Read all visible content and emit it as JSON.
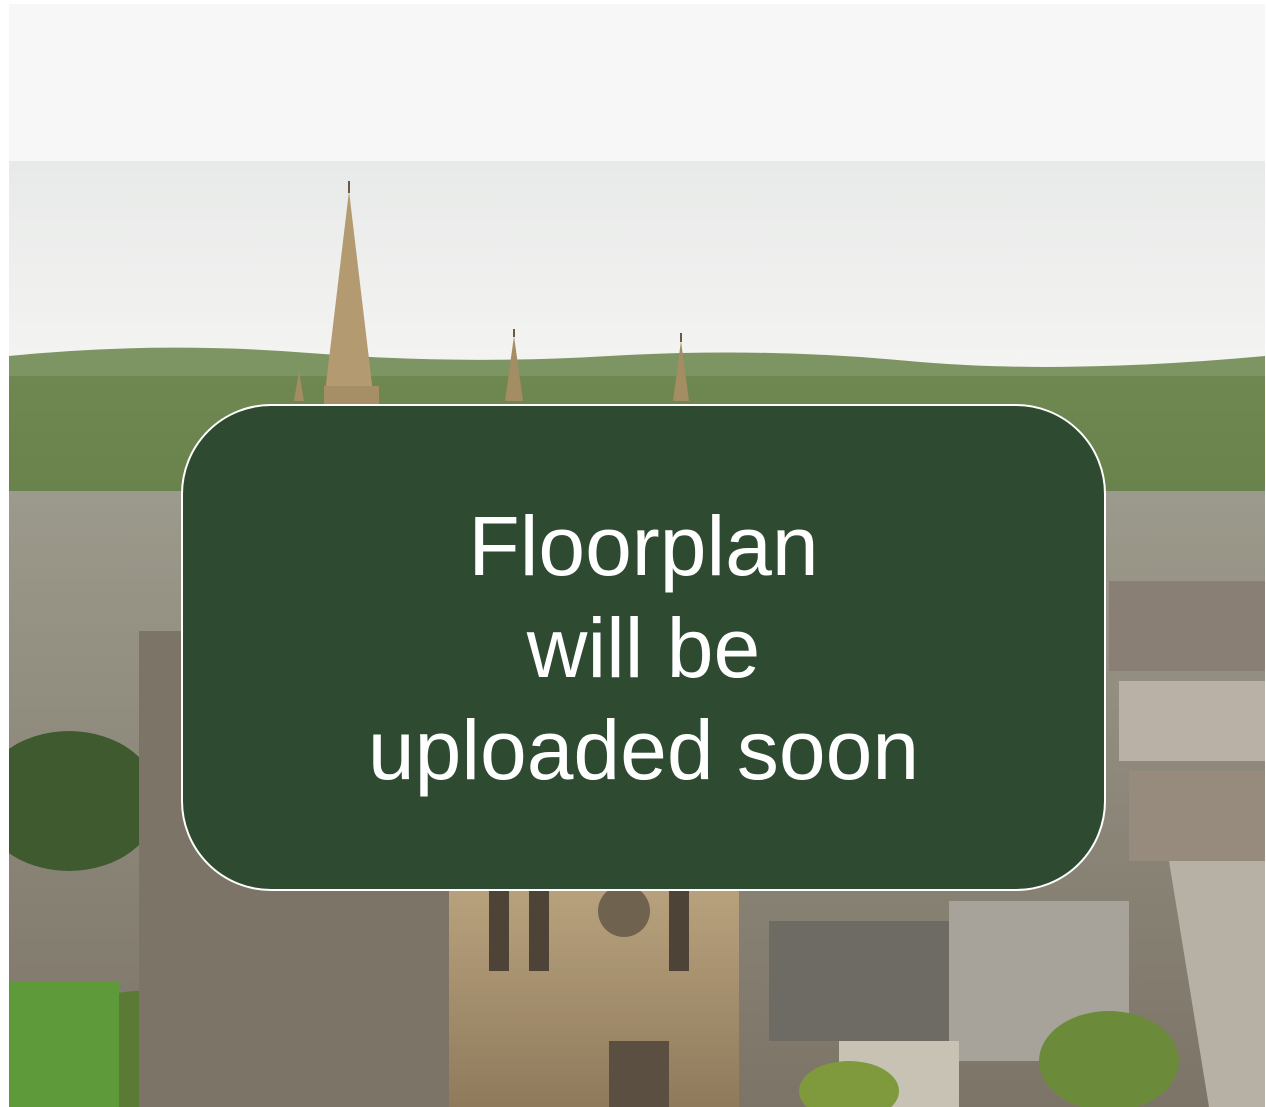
{
  "placeholder": {
    "lines": [
      "Floorplan",
      "will be",
      "uploaded soon"
    ],
    "background_color": "#2e4b32",
    "text_color": "#ffffff"
  },
  "photo": {
    "subject": "aerial-town-cathedral-photo"
  }
}
